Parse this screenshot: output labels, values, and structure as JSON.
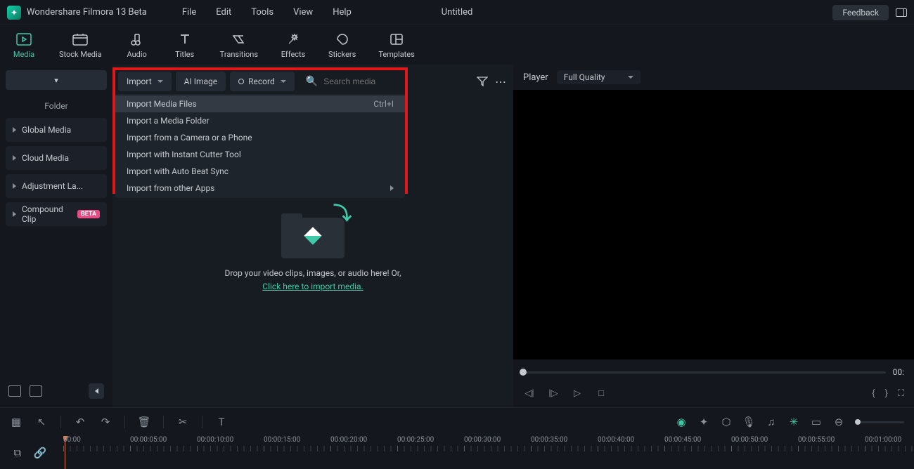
{
  "app_title": "Wondershare Filmora 13 Beta",
  "menus": [
    "File",
    "Edit",
    "Tools",
    "View",
    "Help"
  ],
  "document_title": "Untitled",
  "feedback_label": "Feedback",
  "maintabs": [
    {
      "label": "Media"
    },
    {
      "label": "Stock Media"
    },
    {
      "label": "Audio"
    },
    {
      "label": "Titles"
    },
    {
      "label": "Transitions"
    },
    {
      "label": "Effects"
    },
    {
      "label": "Stickers"
    },
    {
      "label": "Templates"
    }
  ],
  "sidebar": {
    "top_button": "▾",
    "header": "Folder",
    "items": [
      {
        "label": "Global Media"
      },
      {
        "label": "Cloud Media"
      },
      {
        "label": "Adjustment La..."
      },
      {
        "label": "Compound Clip",
        "badge": "BETA"
      }
    ]
  },
  "media_toolbar": {
    "import": "Import",
    "ai_image": "AI Image",
    "record": "Record",
    "search_placeholder": "Search media"
  },
  "import_menu": [
    {
      "label": "Import Media Files",
      "shortcut": "Ctrl+I",
      "hover": true
    },
    {
      "label": "Import a Media Folder"
    },
    {
      "label": "Import from a Camera or a Phone"
    },
    {
      "label": "Import with Instant Cutter Tool"
    },
    {
      "label": "Import with Auto Beat Sync"
    },
    {
      "label": "Import from other Apps",
      "submenu": true
    }
  ],
  "dropzone": {
    "text": "Drop your video clips, images, or audio here! Or,",
    "link": "Click here to import media."
  },
  "preview": {
    "player_label": "Player",
    "quality_label": "Full Quality",
    "time": "00:"
  },
  "ruler_labels": [
    "00:00",
    "00:00:05:00",
    "00:00:10:00",
    "00:00:15:00",
    "00:00:20:00",
    "00:00:25:00",
    "00:00:30:00",
    "00:00:35:00",
    "00:00:40:00",
    "00:00:45:00",
    "00:00:50:00",
    "00:00:55:00",
    "00:01:00:00"
  ]
}
